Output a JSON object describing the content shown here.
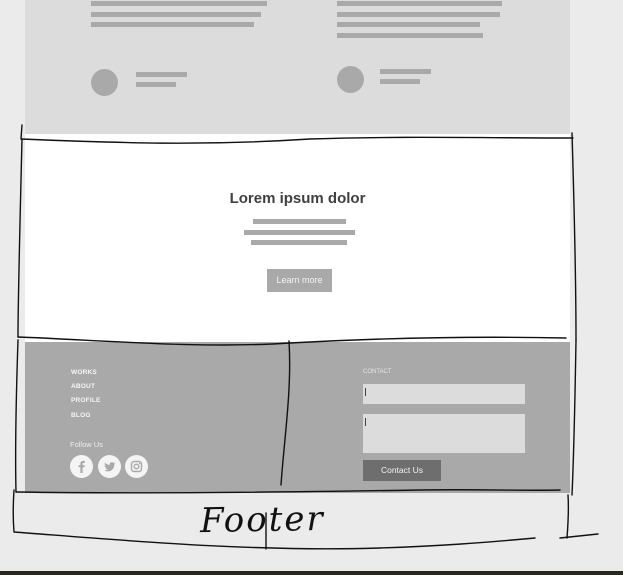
{
  "hero": {
    "title": "Lorem ipsum dolor",
    "button_label": "Learn more"
  },
  "footer": {
    "nav_links": [
      "WORKS",
      "ABOUT",
      "PROFILE",
      "BLOG"
    ],
    "follow_label": "Follow Us",
    "social_icons": [
      "facebook-icon",
      "twitter-icon",
      "instagram-icon"
    ],
    "contact_label": "CONTACT",
    "contact_button_label": "Contact Us"
  },
  "annotation": {
    "footer_text": "Footer"
  },
  "colors": {
    "page_bg": "#ebebeb",
    "placeholder_grey": "#a9a9a9",
    "section_grey": "#dcdcdc",
    "button_dark": "#6e6e6e"
  }
}
